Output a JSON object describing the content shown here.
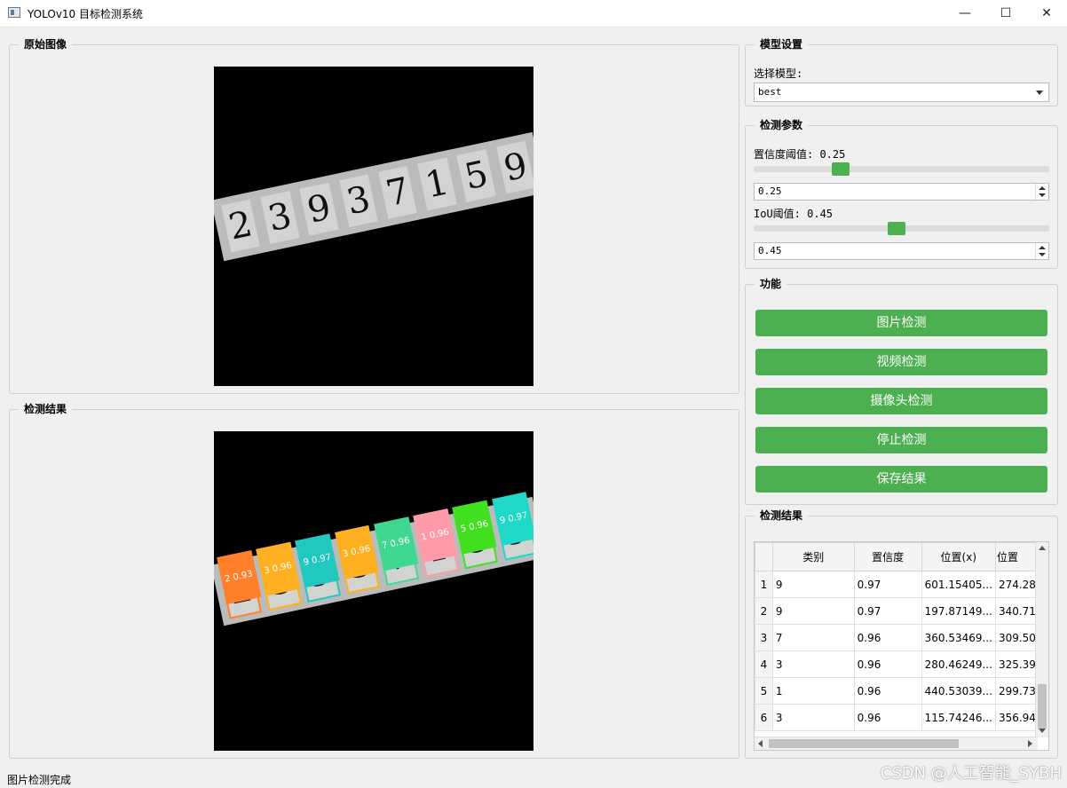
{
  "window": {
    "title": "YOLOv10 目标检测系统",
    "minimize": "—",
    "maximize": "☐",
    "close": "✕"
  },
  "original_panel": {
    "title": "原始图像",
    "digits": [
      "2",
      "3",
      "9",
      "3",
      "7",
      "1",
      "5",
      "9"
    ]
  },
  "result_panel": {
    "title": "检测结果",
    "detections": [
      {
        "digit": "2",
        "label": "2 0.93",
        "color": "#ff7f2a"
      },
      {
        "digit": "3",
        "label": "3 0.96",
        "color": "#ffb020"
      },
      {
        "digit": "9",
        "label": "9 0.97",
        "color": "#20c8c0"
      },
      {
        "digit": "3",
        "label": "3 0.96",
        "color": "#ffb020"
      },
      {
        "digit": "7",
        "label": "7 0.96",
        "color": "#40d890"
      },
      {
        "digit": "1",
        "label": "1 0.96",
        "color": "#ff9aa8"
      },
      {
        "digit": "5",
        "label": "5 0.96",
        "color": "#40e020"
      },
      {
        "digit": "9",
        "label": "9 0.97",
        "color": "#20d8c8"
      }
    ]
  },
  "model_settings": {
    "title": "模型设置",
    "select_label": "选择模型:",
    "selected_model": "best"
  },
  "detect_params": {
    "title": "检测参数",
    "conf_label": "置信度阈值: 0.25",
    "conf_value": "0.25",
    "conf_level": 0.25,
    "iou_label": "IoU阈值: 0.45",
    "iou_value": "0.45",
    "iou_level": 0.45
  },
  "functions": {
    "title": "功能",
    "image_detect": "图片检测",
    "video_detect": "视频检测",
    "camera_detect": "摄像头检测",
    "stop_detect": "停止检测",
    "save_results": "保存结果"
  },
  "results_table": {
    "title": "检测结果",
    "columns": [
      "类别",
      "置信度",
      "位置(x)",
      "位置"
    ],
    "rows": [
      {
        "index": "1",
        "cls": "9",
        "conf": "0.97",
        "x": "601.15405...",
        "y": "274.28"
      },
      {
        "index": "2",
        "cls": "9",
        "conf": "0.97",
        "x": "197.87149...",
        "y": "340.71"
      },
      {
        "index": "3",
        "cls": "7",
        "conf": "0.96",
        "x": "360.53469...",
        "y": "309.50"
      },
      {
        "index": "4",
        "cls": "3",
        "conf": "0.96",
        "x": "280.46249...",
        "y": "325.39"
      },
      {
        "index": "5",
        "cls": "1",
        "conf": "0.96",
        "x": "440.53039...",
        "y": "299.73"
      },
      {
        "index": "6",
        "cls": "3",
        "conf": "0.96",
        "x": "115.74246...",
        "y": "356.94"
      }
    ]
  },
  "status": {
    "text": "图片检测完成"
  },
  "watermark": "CSDN @人工智能_SYBH"
}
